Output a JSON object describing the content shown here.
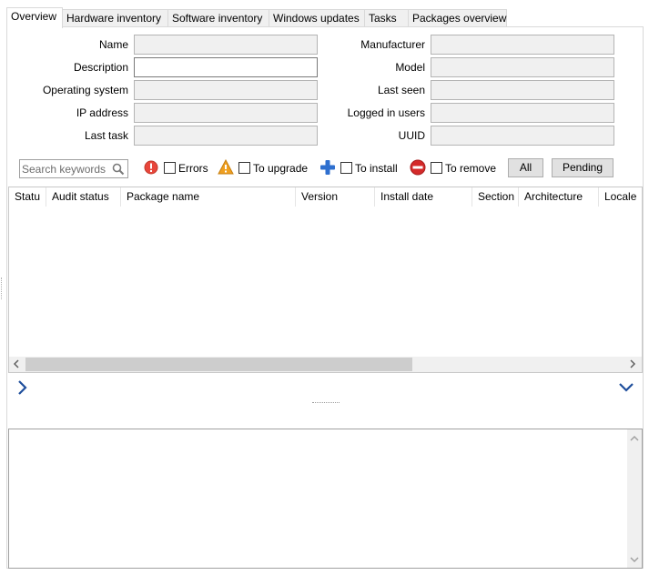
{
  "tabs": [
    {
      "label": "Overview",
      "active": true
    },
    {
      "label": "Hardware inventory"
    },
    {
      "label": "Software inventory"
    },
    {
      "label": "Windows updates"
    },
    {
      "label": "Tasks"
    },
    {
      "label": "Packages overview"
    }
  ],
  "form": {
    "left": [
      {
        "label": "Name",
        "value": ""
      },
      {
        "label": "Description",
        "value": ""
      },
      {
        "label": "Operating system",
        "value": ""
      },
      {
        "label": "IP address",
        "value": ""
      },
      {
        "label": "Last task",
        "value": ""
      }
    ],
    "right": [
      {
        "label": "Manufacturer",
        "value": ""
      },
      {
        "label": "Model",
        "value": ""
      },
      {
        "label": "Last seen",
        "value": ""
      },
      {
        "label": "Logged in users",
        "value": ""
      },
      {
        "label": "UUID",
        "value": ""
      }
    ]
  },
  "filters": {
    "search_placeholder": "Search keywords",
    "errors_label": "Errors",
    "upgrade_label": "To upgrade",
    "install_label": "To install",
    "remove_label": "To remove",
    "all_button": "All",
    "pending_button": "Pending"
  },
  "grid": {
    "columns": [
      "Statu",
      "Audit status",
      "Package name",
      "Version",
      "Install date",
      "Section",
      "Architecture",
      "Locale"
    ]
  },
  "colors": {
    "error": "#e8463b",
    "warning": "#f0a020",
    "install": "#2e6fcf",
    "remove": "#d42a2a",
    "nav_arrow": "#1f4e9c"
  },
  "icons": {
    "search": "search-icon",
    "errors": "error-icon",
    "upgrade": "warning-icon",
    "install": "plus-icon",
    "remove": "no-entry-icon",
    "expand_right": "chevron-right-icon",
    "expand_down": "chevron-down-icon"
  }
}
